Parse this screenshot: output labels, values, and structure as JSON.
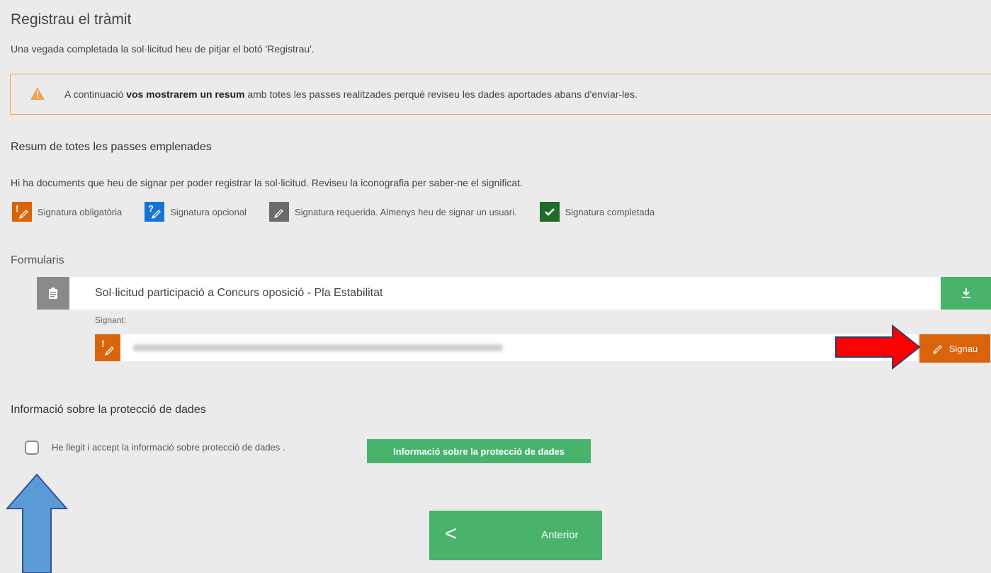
{
  "page": {
    "title": "Registrau el tràmit",
    "intro": "Una vegada completada la sol·licitud heu de pitjar el botó 'Registrau'."
  },
  "warning": {
    "icon": "warning-icon",
    "text_before": "A continuació ",
    "text_bold": "vos mostrarem un resum",
    "text_after": " amb totes les passes realitzades perquè reviseu les dades aportades abans d'enviar-les.",
    "color": "#f0a255"
  },
  "summary": {
    "title": "Resum de totes les passes emplenades",
    "docs_note": "Hi ha documents que heu de signar per poder registrar la sol·licitud. Reviseu la iconografia per saber-ne el significat."
  },
  "legend": [
    {
      "label": "Signatura obligatòria",
      "icon": "mandatory-signature-icon",
      "color": "#d9640a"
    },
    {
      "label": "Signatura opcional",
      "icon": "optional-signature-icon",
      "color": "#1574d4"
    },
    {
      "label": "Signatura requerida. Almenys heu de signar un usuari.",
      "icon": "required-signature-icon",
      "color": "#6b6b6b"
    },
    {
      "label": "Signatura completada",
      "icon": "completed-signature-icon",
      "color": "#1e6b2a"
    }
  ],
  "forms": {
    "label": "Formularis",
    "item_title": "Sol·licitud participació a Concurs oposició - Pla Estabilitat",
    "signant_label": "Signant:",
    "sign_button": "Signau"
  },
  "protection": {
    "title": "Informació sobre la protecció de dades",
    "checkbox_label": "He llegit i accept la informació sobre protecció de dades .",
    "info_button": "Informació sobre la protecció de dades"
  },
  "nav": {
    "prev_chevron": "<",
    "prev_label": "Anterior"
  },
  "colors": {
    "accent_green": "#47b36b",
    "orange": "#d9640a",
    "annotation_red": "#ff0000",
    "annotation_blue": "#5b9bd5"
  }
}
